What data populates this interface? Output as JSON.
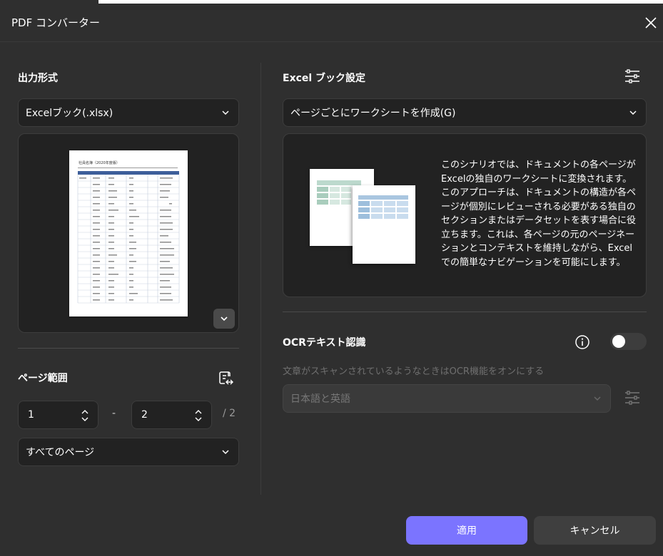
{
  "window": {
    "title": "PDF コンバーター"
  },
  "output_format": {
    "label": "出力形式",
    "selected": "Excelブック(.xlsx)"
  },
  "preview": {
    "doc_title": "社員名簿（2020年度版）"
  },
  "page_range": {
    "label": "ページ範囲",
    "from": "1",
    "separator": "-",
    "to": "2",
    "total": "/ 2",
    "scope_selected": "すべてのページ"
  },
  "excel_settings": {
    "label": "Excel ブック設定",
    "mode_selected": "ページごとにワークシートを作成(G)",
    "description": "このシナリオでは、ドキュメントの各ページがExcelの独自のワークシートに変換されます。このアプローチは、ドキュメントの構造が各ページが個別にレビューされる必要がある独自のセクションまたはデータセットを表す場合に役立ちます。これは、各ページの元のページネーションとコンテキストを維持しながら、Excelでの簡単なナビゲーションを可能にします。"
  },
  "ocr": {
    "label": "OCRテキスト認識",
    "enabled": false,
    "hint": "文章がスキャンされているようなときはOCR機能をオンにする",
    "language_selected": "日本語と英語"
  },
  "buttons": {
    "apply": "適用",
    "cancel": "キャンセル"
  },
  "colors": {
    "background": "#2f2f2f",
    "field": "#222222",
    "accent": "#7b74ff",
    "secondary_button": "#3f3f3f"
  },
  "icons": [
    "close-icon",
    "chevron-down-icon",
    "chevron-up-icon",
    "expand-icon",
    "page-range-icon",
    "settings-sliders-icon",
    "info-icon"
  ]
}
